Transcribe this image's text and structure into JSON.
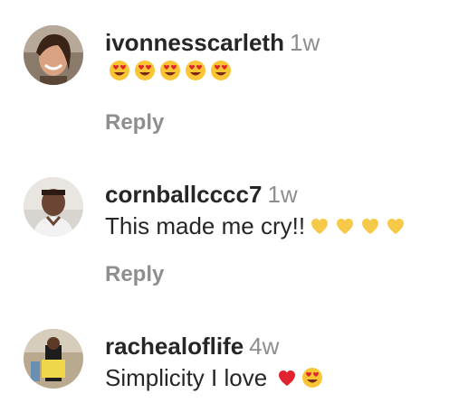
{
  "comments": [
    {
      "username": "ivonnesscarleth",
      "time": "1w",
      "text": "",
      "emojis": [
        "heart-eyes-emoji",
        "heart-eyes-emoji",
        "heart-eyes-emoji",
        "heart-eyes-emoji",
        "heart-eyes-emoji"
      ],
      "reply_label": "Reply"
    },
    {
      "username": "cornballcccc7",
      "time": "1w",
      "text": "This made me cry!!",
      "emojis": [
        "yellow-heart-emoji",
        "yellow-heart-emoji",
        "yellow-heart-emoji",
        "yellow-heart-emoji"
      ],
      "reply_label": "Reply"
    },
    {
      "username": "rachealoflife",
      "time": "4w",
      "text": "Simplicity I love",
      "emojis": [
        "red-heart-emoji",
        "heart-eyes-emoji"
      ],
      "reply_label": ""
    }
  ],
  "colors": {
    "text": "#262626",
    "muted": "#8e8e8e",
    "yellow_heart": "#f7c948",
    "red_heart": "#e0232e",
    "emoji_face": "#f9c534"
  }
}
